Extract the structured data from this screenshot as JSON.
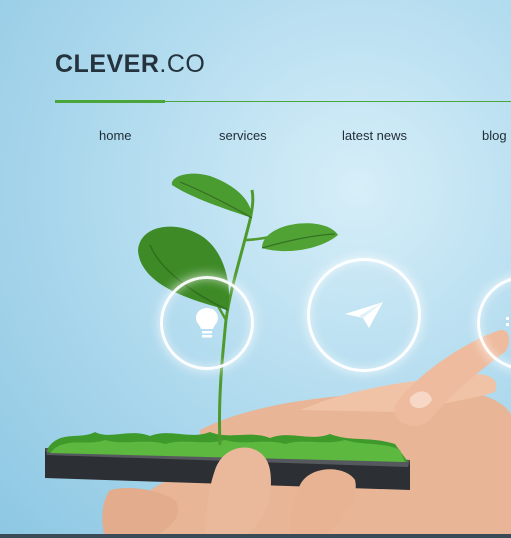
{
  "brand": {
    "name_bold": "CLEVER",
    "name_rest": ".CO"
  },
  "nav": {
    "items": [
      {
        "label": "home"
      },
      {
        "label": "services"
      },
      {
        "label": "latest news"
      },
      {
        "label": "blog"
      }
    ]
  },
  "icons": {
    "feature_1": "lightbulb-icon",
    "feature_2": "paper-plane-icon",
    "feature_3": "partial-icon"
  },
  "colors": {
    "accent": "#4aa63a",
    "logo_text": "#24333d",
    "background": "#b3dcef"
  }
}
